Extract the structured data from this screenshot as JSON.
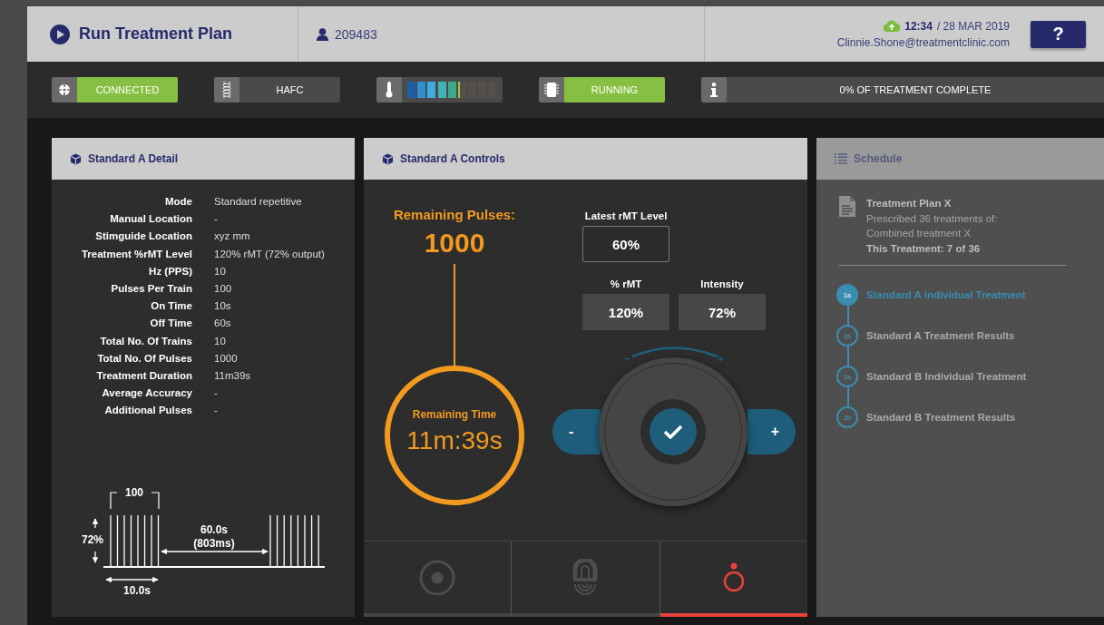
{
  "header": {
    "title": "Run Treatment Plan",
    "patient_id": "209483",
    "time": "12:34",
    "date": "/ 28 MAR 2019",
    "email": "Clinnie.Shone@treatmentclinic.com",
    "help_label": "?"
  },
  "status_bar": [
    {
      "kind": "crosshair",
      "label": "CONNECTED",
      "active": true
    },
    {
      "kind": "coil",
      "label": "HAFC",
      "active": false
    },
    {
      "kind": "thermometer",
      "level": 0.6
    },
    {
      "kind": "chip",
      "label": "RUNNING",
      "active": true
    },
    {
      "kind": "info",
      "label": "0% OF TREATMENT COMPLETE",
      "active": false
    }
  ],
  "detail_panel": {
    "title": "Standard A Detail",
    "rows": [
      {
        "label": "Mode",
        "value": "Standard repetitive"
      },
      {
        "label": "Manual Location",
        "value": "-"
      },
      {
        "label": "Stimguide Location",
        "value": "xyz mm"
      },
      {
        "label": "Treatment  %rMT Level",
        "value": "120% rMT (72% output)"
      },
      {
        "label": "Hz (PPS)",
        "value": "10"
      },
      {
        "label": "Pulses Per Train",
        "value": "100"
      },
      {
        "label": "On Time",
        "value": "10s"
      },
      {
        "label": "Off Time",
        "value": "60s"
      },
      {
        "label": "Total No. Of Trains",
        "value": "10"
      },
      {
        "label": "Total No. Of Pulses",
        "value": "1000"
      },
      {
        "label": "Treatment Duration",
        "value": "11m39s"
      },
      {
        "label": "Average Accuracy",
        "value": "-"
      },
      {
        "label": "Additional Pulses",
        "value": "-"
      }
    ],
    "pulse_diagram": {
      "train_count_label": "100",
      "amplitude_label": "72%",
      "interval_label": "60.0s",
      "interval_sub_label": "(803ms)",
      "train_duration_label": "10.0s"
    }
  },
  "controls_panel": {
    "title": "Standard A Controls",
    "remaining_pulses_label": "Remaining Pulses:",
    "remaining_pulses": "1000",
    "remaining_time_label": "Remaining Time",
    "remaining_time": "11m:39s",
    "latest_rmt": {
      "label": "Latest rMT Level",
      "value": "60%"
    },
    "settings": [
      {
        "label": "% rMT",
        "value": "120%"
      },
      {
        "label": "Intensity",
        "value": "72%"
      }
    ],
    "decrease_label": "-",
    "increase_label": "+",
    "mode_tabs": [
      {
        "kind": "target",
        "selected": false
      },
      {
        "kind": "coil",
        "selected": false
      },
      {
        "kind": "pin",
        "selected": true
      }
    ]
  },
  "schedule_panel": {
    "title": "Schedule",
    "plan_title": "Treatment Plan X",
    "plan_lines": [
      "Prescribed 36 treatments of:",
      "Combined treatment X"
    ],
    "progress": "This Treatment: 7 of 36",
    "steps": [
      {
        "badge": "1a",
        "label": "Standard A Individual Treatment",
        "selected": true
      },
      {
        "badge": "1b",
        "label": "Standard A Treatment Results",
        "selected": false
      },
      {
        "badge": "2a",
        "label": "Standard B Individual Treatment",
        "selected": false
      },
      {
        "badge": "2b",
        "label": "Standard B Treatment Results",
        "selected": false
      }
    ]
  }
}
